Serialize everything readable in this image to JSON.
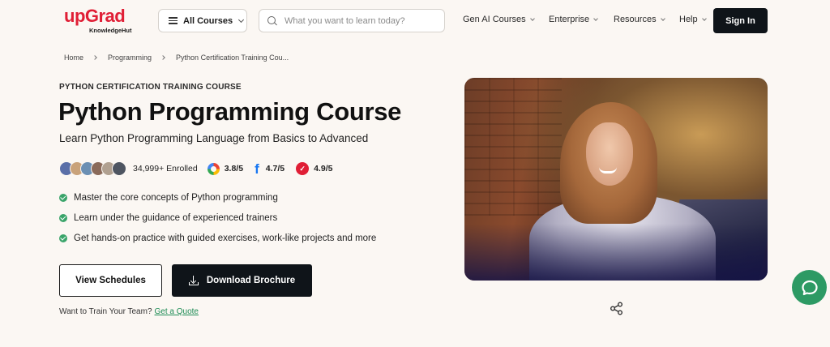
{
  "header": {
    "logo": {
      "brand": "upGrad",
      "sub": "KnowledgeHut"
    },
    "all_courses_label": "All Courses",
    "search_placeholder": "What you want to learn today?",
    "nav": [
      {
        "label": "Gen AI Courses"
      },
      {
        "label": "Enterprise"
      },
      {
        "label": "Resources"
      },
      {
        "label": "Help"
      }
    ],
    "signin_label": "Sign In"
  },
  "breadcrumb": [
    "Home",
    "Programming",
    "Python Certification Training Cou..."
  ],
  "hero": {
    "eyebrow": "PYTHON CERTIFICATION TRAINING COURSE",
    "title": "Python Programming Course",
    "subtitle": "Learn Python Programming Language from Basics to Advanced",
    "enrolled": "34,999+ Enrolled",
    "ratings": {
      "google": "3.8/5",
      "facebook": "4.7/5",
      "switchup": "4.9/5"
    },
    "bullets": [
      "Master the core concepts of Python programming",
      "Learn under the guidance of experienced trainers",
      "Get hands-on practice with guided exercises, work-like projects and more"
    ],
    "view_schedules_label": "View Schedules",
    "download_brochure_label": "Download Brochure",
    "train_team_text": "Want to Train Your Team?",
    "quote_link": "Get a Quote"
  },
  "colors": {
    "brand_red": "#e01e35",
    "dark": "#0f1419",
    "green": "#2d9a64",
    "background": "#fbf7f3"
  }
}
